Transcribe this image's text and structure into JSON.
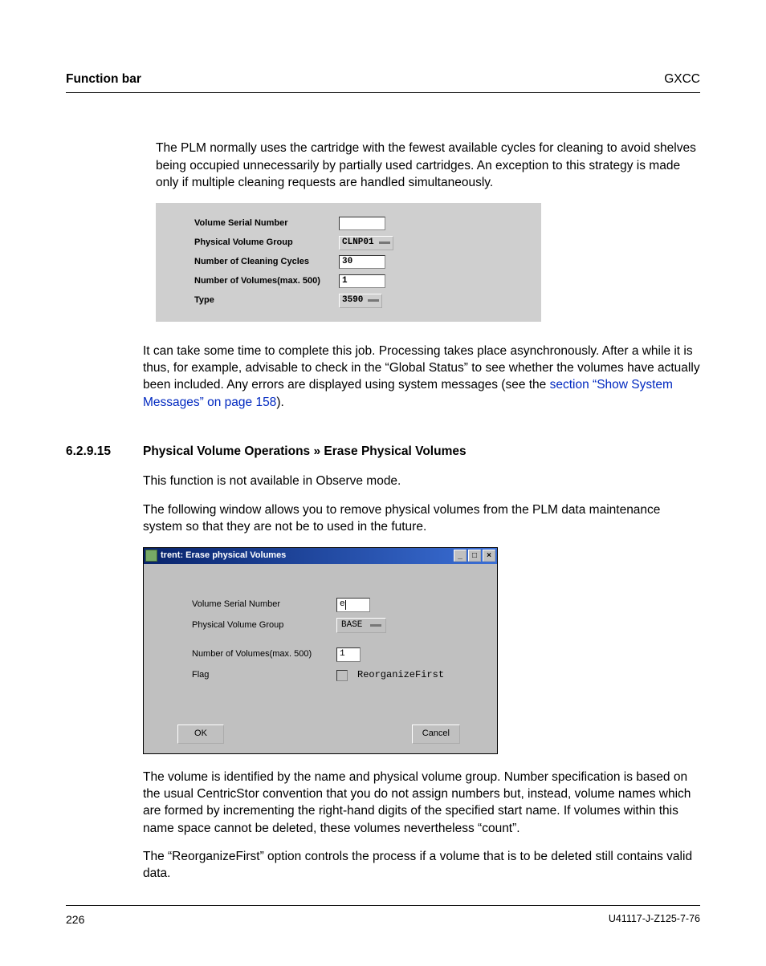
{
  "header": {
    "left": "Function bar",
    "right": "GXCC"
  },
  "intro_para": "The PLM normally uses the cartridge with the fewest available cycles for cleaning to avoid shelves being occupied unnecessarily by partially used cartridges. An exception to this strategy is made only if multiple cleaning requests are handled simultaneously.",
  "shot1": {
    "rows": {
      "vsn": {
        "label": "Volume Serial Number",
        "value": ""
      },
      "pvg": {
        "label": "Physical Volume Group",
        "value": "CLNP01"
      },
      "ncc": {
        "label": "Number of Cleaning Cycles",
        "value": "30"
      },
      "nvol": {
        "label": "Number of Volumes(max. 500)",
        "value": "1"
      },
      "type": {
        "label": "Type",
        "value": "3590"
      }
    }
  },
  "after_shot1_pre": "It can take some time to complete this job. Processing takes place asynchronously. After a while it is thus, for example, advisable to check in the “Global Status” to see whether the volumes have actually been included. Any errors are displayed using system messages (see the ",
  "after_shot1_link": "section “Show System Messages” on page 158",
  "after_shot1_post": ").",
  "section": {
    "num": "6.2.9.15",
    "title": "Physical Volume Operations » Erase Physical Volumes"
  },
  "para_observe": "This function is not available in Observe mode.",
  "para_following": "The following window allows you to remove physical volumes from the PLM data maintenance system so that they are not be to used in the future.",
  "shot2": {
    "title": "trent: Erase physical Volumes",
    "rows": {
      "vsn": {
        "label": "Volume Serial Number",
        "value": "e"
      },
      "pvg": {
        "label": "Physical Volume Group",
        "value": "BASE"
      },
      "nvol": {
        "label": "Number of Volumes(max. 500)",
        "value": "1"
      },
      "flag": {
        "label": "Flag",
        "text": "ReorganizeFirst"
      }
    },
    "buttons": {
      "ok": "OK",
      "cancel": "Cancel"
    }
  },
  "para_identified": "The volume is identified by the name and physical volume group. Number specification is based on the usual CentricStor convention that you do not assign numbers but, instead, volume names which are formed by incrementing the right-hand digits of the specified start name. If volumes within this name space cannot be deleted, these volumes nevertheless “count”.",
  "para_reorg": "The “ReorganizeFirst” option controls the process if a volume that is to be deleted still contains valid data.",
  "footer": {
    "left": "226",
    "right": "U41117-J-Z125-7-76"
  }
}
